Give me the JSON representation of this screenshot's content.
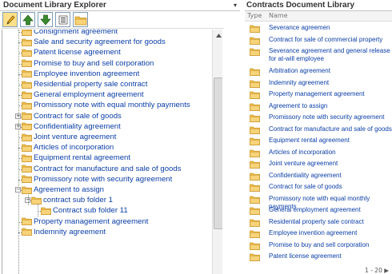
{
  "left_panel": {
    "title": "Document Library Explorer",
    "menu_glyph": "▾",
    "toolbar": [
      "edit-pencil-icon",
      "move-up-arrow-icon",
      "move-down-arrow-icon",
      "list-view-icon",
      "new-folder-icon"
    ],
    "tree": [
      {
        "label": "Consignment agreement",
        "depth": 0,
        "expandable": false
      },
      {
        "label": "Sale and security agreement for goods",
        "depth": 0,
        "expandable": false
      },
      {
        "label": "Patent license agreement",
        "depth": 0,
        "expandable": false
      },
      {
        "label": "Promise to buy and sell corporation",
        "depth": 0,
        "expandable": false
      },
      {
        "label": "Employee invention agreement",
        "depth": 0,
        "expandable": false
      },
      {
        "label": "Residential property sale contract",
        "depth": 0,
        "expandable": false
      },
      {
        "label": "General employment agreement",
        "depth": 0,
        "expandable": false
      },
      {
        "label": "Promissory note with equal monthly payments",
        "depth": 0,
        "expandable": false
      },
      {
        "label": "Contract for sale of goods",
        "depth": 0,
        "expandable": true,
        "expanded": false
      },
      {
        "label": "Confidentiality agreement",
        "depth": 0,
        "expandable": true,
        "expanded": false
      },
      {
        "label": "Joint venture agreement",
        "depth": 0,
        "expandable": false
      },
      {
        "label": "Articles of incorporation",
        "depth": 0,
        "expandable": false
      },
      {
        "label": "Equipment rental agreement",
        "depth": 0,
        "expandable": false
      },
      {
        "label": "Contract for manufacture and sale of goods",
        "depth": 0,
        "expandable": false
      },
      {
        "label": "Promissory note with security agreement",
        "depth": 0,
        "expandable": false
      },
      {
        "label": "Agreement to assign",
        "depth": 0,
        "expandable": true,
        "expanded": true
      },
      {
        "label": "contract sub folder 1",
        "depth": 1,
        "expandable": true,
        "expanded": true
      },
      {
        "label": "Contract sub folder 11",
        "depth": 2,
        "expandable": false
      },
      {
        "label": "Property management agreement",
        "depth": 0,
        "expandable": false
      },
      {
        "label": "Indemnity agreement",
        "depth": 0,
        "expandable": false
      }
    ]
  },
  "right_panel": {
    "title": "Contracts Document Library",
    "columns": {
      "type": "Type",
      "name": "Name"
    },
    "rows": [
      {
        "name": "Severance agreemen",
        "lines": 1
      },
      {
        "name": "Contract for sale of commercial property",
        "lines": 1
      },
      {
        "name": "Severance agreement and general release for at-will employee",
        "lines": 2
      },
      {
        "name": "Arbitration agreement",
        "lines": 1
      },
      {
        "name": "Indemnity agreement",
        "lines": 1
      },
      {
        "name": "Property management agreement",
        "lines": 1
      },
      {
        "name": "Agreement to assign",
        "lines": 1
      },
      {
        "name": "Promissory note with security agreement",
        "lines": 1
      },
      {
        "name": "Contract for manufacture and sale of goods",
        "lines": 1
      },
      {
        "name": "Equipment rental agreement",
        "lines": 1
      },
      {
        "name": "Articles of incorporation",
        "lines": 1
      },
      {
        "name": "Joint venture agreement",
        "lines": 1
      },
      {
        "name": "Confidentiality agreement",
        "lines": 1
      },
      {
        "name": "Contract for sale of goods",
        "lines": 1
      },
      {
        "name": "Promissory note with equal monthly payments",
        "lines": 1
      },
      {
        "name": "General employment agreement",
        "lines": 1
      },
      {
        "name": "Residential property sale contract",
        "lines": 1
      },
      {
        "name": "Employee invention agreement",
        "lines": 1
      },
      {
        "name": "Promise to buy and sell corporation",
        "lines": 1
      },
      {
        "name": "Patent license agreement",
        "lines": 1
      }
    ],
    "pager": "1 - 20 ▶"
  },
  "colors": {
    "link": "#0b3ea7",
    "folder_fill": "#f2c14e",
    "folder_edge": "#c9962a",
    "toolbar_highlight": "#ffe08a",
    "arrow_green": "#3a8a2e"
  }
}
